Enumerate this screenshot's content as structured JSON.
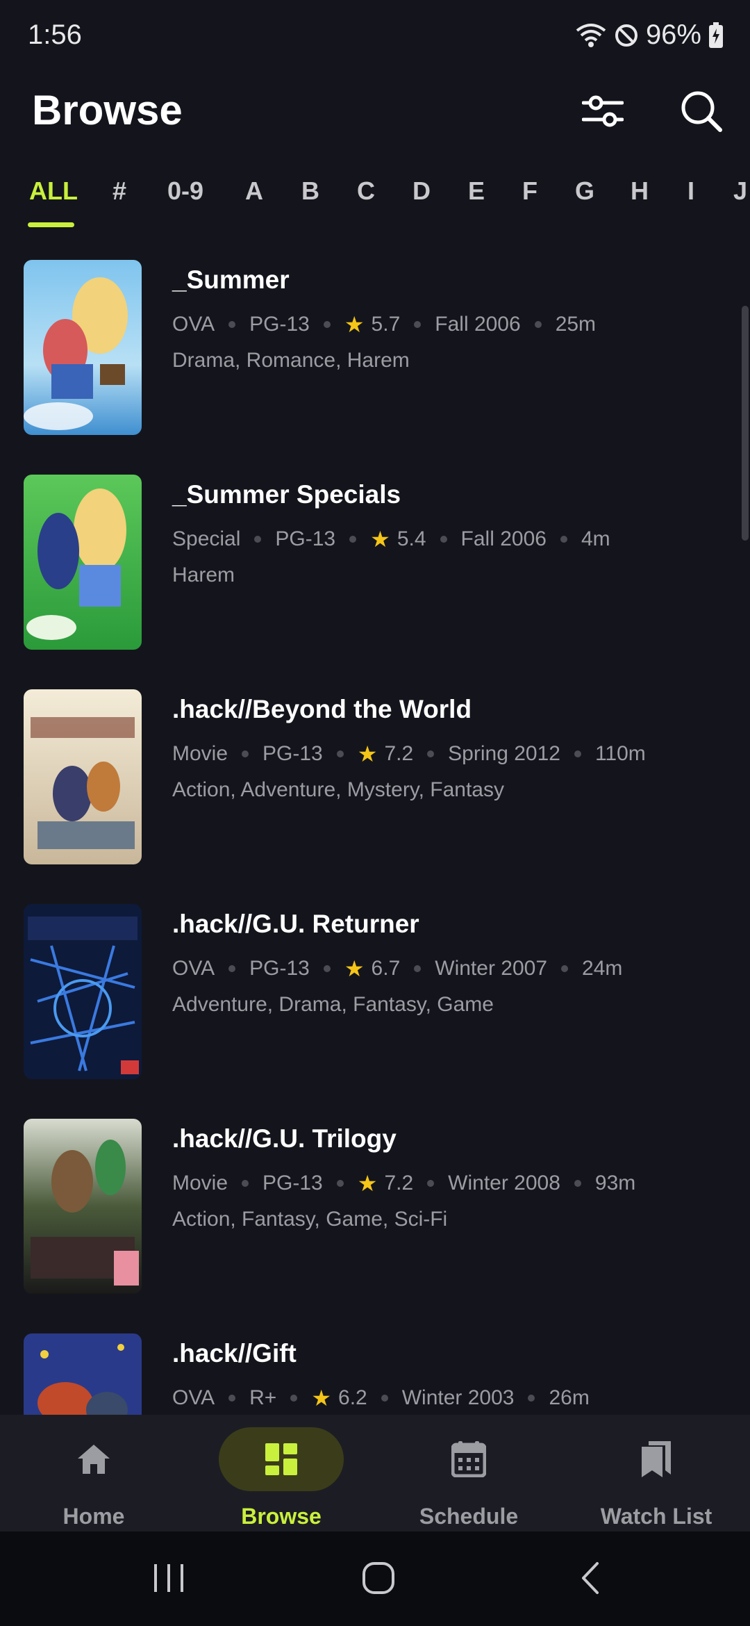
{
  "status_bar": {
    "time": "1:56",
    "battery": "96%"
  },
  "header": {
    "title": "Browse"
  },
  "alphabet": {
    "active": "ALL",
    "items": [
      "ALL",
      "#",
      "0-9",
      "A",
      "B",
      "C",
      "D",
      "E",
      "F",
      "G",
      "H",
      "I",
      "J"
    ]
  },
  "list": [
    {
      "title": "_Summer",
      "type": "OVA",
      "rating": "PG-13",
      "score": "5.7",
      "season": "Fall 2006",
      "duration": "25m",
      "genres": "Drama, Romance, Harem"
    },
    {
      "title": "_Summer Specials",
      "type": "Special",
      "rating": "PG-13",
      "score": "5.4",
      "season": "Fall 2006",
      "duration": "4m",
      "genres": "Harem"
    },
    {
      "title": ".hack//Beyond the World",
      "type": "Movie",
      "rating": "PG-13",
      "score": "7.2",
      "season": "Spring 2012",
      "duration": "110m",
      "genres": "Action, Adventure, Mystery, Fantasy"
    },
    {
      "title": ".hack//G.U. Returner",
      "type": "OVA",
      "rating": "PG-13",
      "score": "6.7",
      "season": "Winter 2007",
      "duration": "24m",
      "genres": "Adventure, Drama, Fantasy, Game"
    },
    {
      "title": ".hack//G.U. Trilogy",
      "type": "Movie",
      "rating": "PG-13",
      "score": "7.2",
      "season": "Winter 2008",
      "duration": "93m",
      "genres": "Action, Fantasy, Game, Sci-Fi"
    },
    {
      "title": ".hack//Gift",
      "type": "OVA",
      "rating": "R+",
      "score": "6.2",
      "season": "Winter 2003",
      "duration": "26m",
      "genres": ""
    }
  ],
  "bottom_nav": {
    "active": "Browse",
    "items": [
      {
        "label": "Home",
        "icon": "home-icon"
      },
      {
        "label": "Browse",
        "icon": "grid-icon"
      },
      {
        "label": "Schedule",
        "icon": "calendar-icon"
      },
      {
        "label": "Watch List",
        "icon": "bookmarks-icon"
      }
    ]
  },
  "colors": {
    "accent": "#c9f03c",
    "background": "#14151c",
    "star": "#f5c518"
  }
}
